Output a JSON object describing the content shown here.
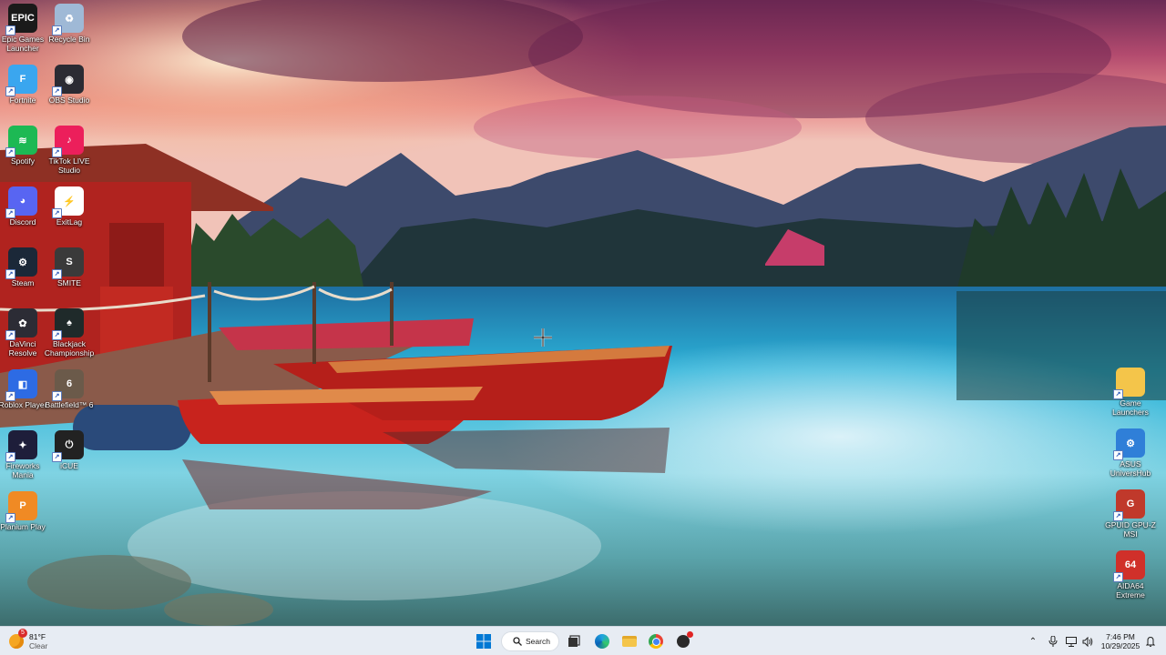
{
  "desktop_left": [
    {
      "label": "Epic Games Launcher",
      "icon": "epic-games-icon",
      "color": "#1a1a1a",
      "glyph": "EPIC"
    },
    {
      "label": "Recycle Bin",
      "icon": "recycle-bin-icon",
      "color": "#9fb9d6",
      "glyph": "♻"
    },
    {
      "label": "Fortnite",
      "icon": "fortnite-icon",
      "color": "#3aa6ef",
      "glyph": "F"
    },
    {
      "label": "OBS Studio",
      "icon": "obs-studio-icon",
      "color": "#2b2b33",
      "glyph": "◉"
    },
    {
      "label": "Spotify",
      "icon": "spotify-icon",
      "color": "#1db954",
      "glyph": "≋"
    },
    {
      "label": "TikTok LIVE Studio",
      "icon": "tiktok-live-icon",
      "color": "#ec1f5b",
      "glyph": "♪"
    },
    {
      "label": "Discord",
      "icon": "discord-icon",
      "color": "#5865f2",
      "glyph": "◕"
    },
    {
      "label": "ExitLag",
      "icon": "exitlag-icon",
      "color": "#ffffff",
      "glyph": "⚡"
    },
    {
      "label": "Steam",
      "icon": "steam-icon",
      "color": "#1b2838",
      "glyph": "⚙"
    },
    {
      "label": "SMITE",
      "icon": "smite-icon",
      "color": "#3a3a3a",
      "glyph": "S"
    },
    {
      "label": "DaVinci Resolve",
      "icon": "davinci-resolve-icon",
      "color": "#2c2c35",
      "glyph": "✿"
    },
    {
      "label": "Blackjack Championship",
      "icon": "blackjack-icon",
      "color": "#1f2a2a",
      "glyph": "♠"
    },
    {
      "label": "Roblox Player",
      "icon": "roblox-icon",
      "color": "#2d6be4",
      "glyph": "◧"
    },
    {
      "label": "Battlefield™ 6",
      "icon": "battlefield-icon",
      "color": "#6b5a4a",
      "glyph": "6"
    },
    {
      "label": "Fireworks Mania",
      "icon": "fireworks-mania-icon",
      "color": "#1e1e3a",
      "glyph": "✦"
    },
    {
      "label": "iCUE",
      "icon": "icue-icon",
      "color": "#222222",
      "glyph": "⏻"
    },
    {
      "label": "Planium Play",
      "icon": "planium-play-icon",
      "color": "#f08a24",
      "glyph": "P"
    }
  ],
  "desktop_right": [
    {
      "label": "Game Launchers",
      "icon": "folder-icon",
      "color": "#f4c54a",
      "glyph": ""
    },
    {
      "label": "ASUS UniversHub",
      "icon": "asus-hub-icon",
      "color": "#2f7fd8",
      "glyph": "⚙"
    },
    {
      "label": "GPUID GPU-Z MSI",
      "icon": "gpuz-icon",
      "color": "#c0392b",
      "glyph": "G"
    },
    {
      "label": "AIDA64 Extreme",
      "icon": "aida64-icon",
      "color": "#d0302a",
      "glyph": "64"
    }
  ],
  "taskbar": {
    "weather_temp": "81°F",
    "weather_desc": "Clear",
    "weather_badge": "5",
    "search_label": "Search",
    "time": "7:46 PM",
    "date": "10/29/2025"
  },
  "colors": {
    "taskbar_bg": "#e7ecf3",
    "accent": "#0067c0"
  }
}
